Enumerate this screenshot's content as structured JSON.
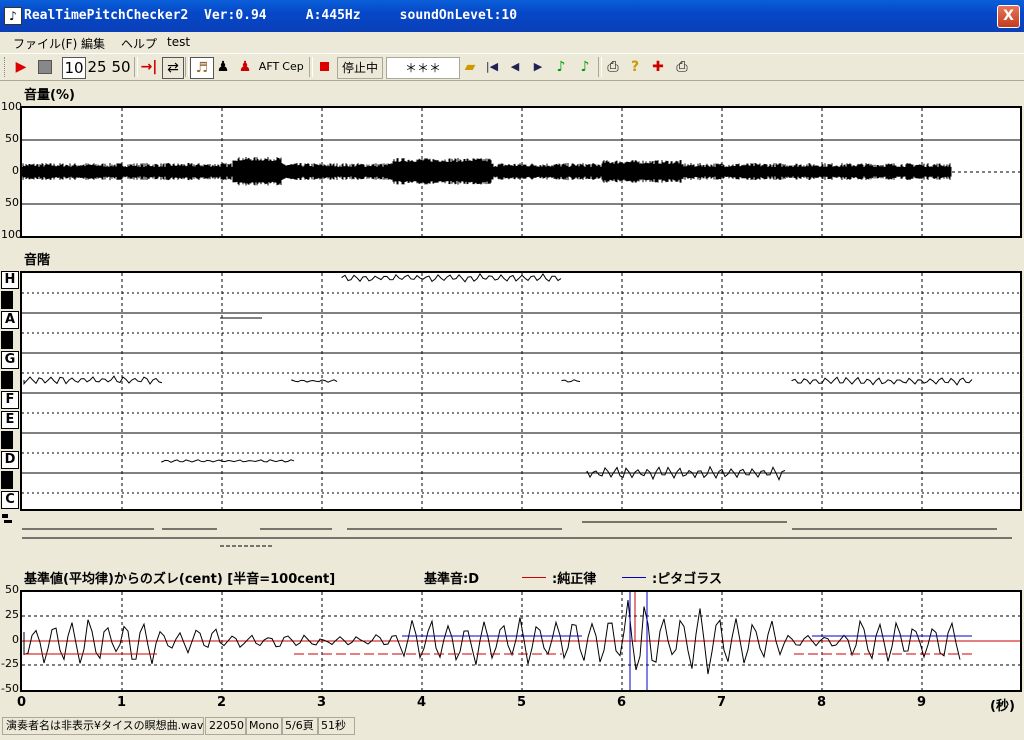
{
  "window": {
    "title": "RealTimePitchChecker2  Ver:0.94     A:445Hz     soundOnLevel:10",
    "close_label": "X"
  },
  "menu": [
    "ファイル(F)",
    "編集",
    "ヘルプ",
    "test"
  ],
  "toolbar": {
    "play_icon": "play-icon",
    "stop_icon": "stop-icon",
    "speed_10": "10",
    "speed_25": "25",
    "speed_50": "50",
    "aft_label": "AFT",
    "cep_label": "Cep",
    "status_label": "停止中",
    "note_readout": "＊＊＊"
  },
  "volume_panel": {
    "title": "音量(%)",
    "y_ticks": [
      "100",
      "50",
      "0",
      "50",
      "100"
    ]
  },
  "scale_panel": {
    "title": "音階",
    "notes": [
      "H",
      "A",
      "G",
      "F",
      "E",
      "D",
      "C"
    ]
  },
  "deviation_panel": {
    "title": "基準値(平均律)からのズレ(cent) [半音=100cent]",
    "base_note": "基準音:D",
    "legend_just": ":純正律",
    "legend_pyth": ":ピタゴラス",
    "y_ticks": [
      "50",
      "25",
      "0",
      "-25",
      "-50"
    ],
    "x_unit": "(秒)"
  },
  "chart_data": {
    "type": "line",
    "x_ticks": [
      "0",
      "1",
      "2",
      "3",
      "4",
      "5",
      "6",
      "7",
      "8",
      "9"
    ],
    "xlim": [
      0,
      9.8
    ],
    "volume_ylim": [
      -100,
      100
    ],
    "deviation_ylim": [
      -50,
      50
    ],
    "colors": {
      "just": "#cc0000",
      "pythagorean": "#0000cc",
      "trace": "#000000"
    }
  },
  "statusbar": {
    "file": "演奏者名は非表示¥タイスの瞑想曲.wav",
    "rate": "22050",
    "channels": "Mono",
    "page": "5/6頁",
    "duration": "51秒"
  }
}
